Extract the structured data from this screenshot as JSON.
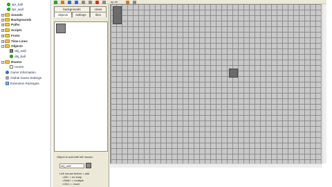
{
  "tree": {
    "items": [
      {
        "label": "spr_ball",
        "icon": "green"
      },
      {
        "label": "spr_wall",
        "icon": "green"
      },
      {
        "label": "Sounds",
        "icon": "folder"
      },
      {
        "label": "Backgrounds",
        "icon": "folder"
      },
      {
        "label": "Paths",
        "icon": "folder"
      },
      {
        "label": "Scripts",
        "icon": "folder"
      },
      {
        "label": "Fonts",
        "icon": "folder"
      },
      {
        "label": "Time Lines",
        "icon": "folder"
      },
      {
        "label": "Objects",
        "icon": "folder"
      },
      {
        "label": "obj_wall",
        "icon": "gray-tile"
      },
      {
        "label": "obj_ball",
        "icon": "green"
      },
      {
        "label": "Rooms",
        "icon": "folder"
      },
      {
        "label": "room0",
        "icon": "room"
      },
      {
        "label": "Game Information",
        "icon": "info"
      },
      {
        "label": "Global Game Settings",
        "icon": "gear"
      },
      {
        "label": "Extension Packages",
        "icon": "package"
      }
    ]
  },
  "toolbar": {
    "zoom_label": "ap ab",
    "colors": {
      "green": "#2e9b3c",
      "blue": "#3b66c4",
      "red": "#c0392b",
      "gray": "#8a8a8a"
    }
  },
  "panel": {
    "tabs_top": [
      "backgrounds",
      "views"
    ],
    "tabs_bottom": [
      "objects",
      "settings",
      "tiles"
    ],
    "selected_tab": "objects",
    "object_to_add_label": "Object to add with left mouse:",
    "object_name": "obj_wall",
    "help_lines": [
      "Left mouse button = add",
      "<Alt> = no snap",
      "<Shift> = multiple",
      "<Ctrl> = move"
    ]
  }
}
